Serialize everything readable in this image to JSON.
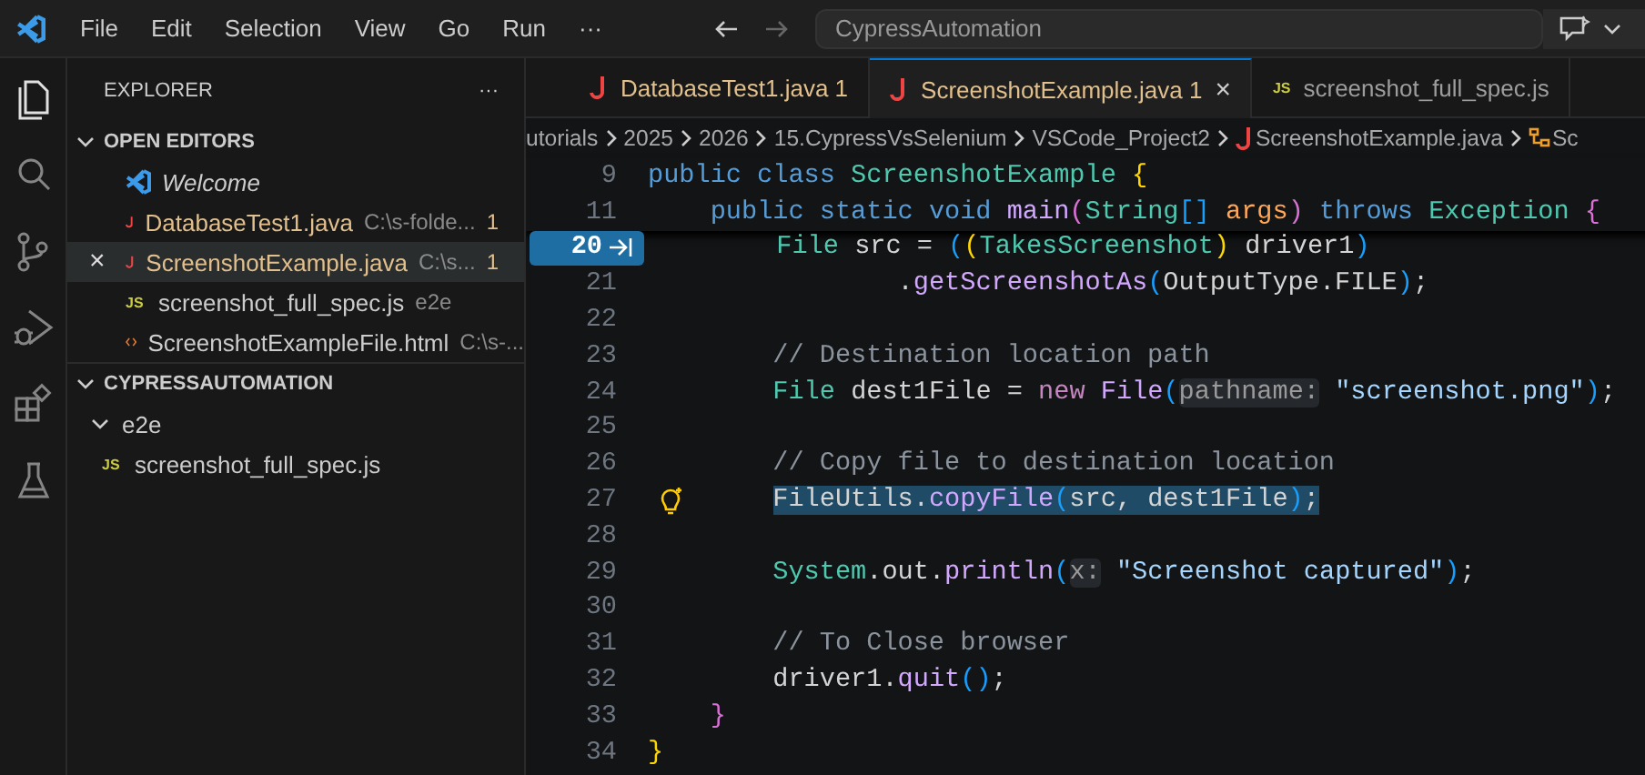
{
  "title_bar": {
    "menus": [
      "File",
      "Edit",
      "Selection",
      "View",
      "Go",
      "Run",
      "···"
    ],
    "search": {
      "value": "CypressAutomation"
    }
  },
  "activity_bar": {
    "items": [
      {
        "kind": "files",
        "selected": true
      },
      {
        "kind": "search",
        "selected": false
      },
      {
        "kind": "source-control",
        "selected": false
      },
      {
        "kind": "run-debug",
        "selected": false
      },
      {
        "kind": "extensions",
        "selected": false
      },
      {
        "kind": "testing",
        "selected": false
      }
    ]
  },
  "sidebar": {
    "title": "EXPLORER",
    "more": "···",
    "sections": [
      {
        "title": "OPEN EDITORS",
        "expanded": true,
        "items": [
          {
            "kind": "vscode",
            "name": "Welcome",
            "italic": true,
            "selected": false,
            "warning": false
          },
          {
            "kind": "java",
            "name": "DatabaseTest1.java",
            "detail": "C:\\s-folde...",
            "badge": "1",
            "selected": false,
            "warning": true
          },
          {
            "kind": "java",
            "name": "ScreenshotExample.java",
            "detail": "C:\\s...",
            "badge": "1",
            "selected": true,
            "warning": true,
            "close": "×"
          },
          {
            "kind": "js",
            "icon": "JS",
            "name": "screenshot_full_spec.js",
            "detail": "e2e",
            "selected": false,
            "warning": false
          },
          {
            "kind": "html",
            "name": "ScreenshotExampleFile.html",
            "detail": "C:\\s-...",
            "selected": false,
            "warning": false
          }
        ]
      },
      {
        "title": "CYPRESSAUTOMATION",
        "expanded": true,
        "tree": [
          {
            "kind": "folder",
            "name": "e2e",
            "expanded": true,
            "children": [
              {
                "kind": "js",
                "icon": "JS",
                "name": "screenshot_full_spec.js"
              }
            ]
          }
        ]
      }
    ]
  },
  "tabs": [
    {
      "kind": "java",
      "label": "DatabaseTest1.java",
      "badge": "1",
      "selected": false,
      "warning": true
    },
    {
      "kind": "java",
      "label": "ScreenshotExample.java",
      "badge": "1",
      "selected": true,
      "warning": true,
      "close": "×"
    },
    {
      "kind": "js",
      "icon": "JS",
      "label": "screenshot_full_spec.js",
      "selected": false,
      "warning": false
    }
  ],
  "breadcrumb": [
    {
      "kind": "folder",
      "label": "utorials"
    },
    {
      "kind": "folder",
      "label": "2025"
    },
    {
      "kind": "folder",
      "label": "2026"
    },
    {
      "kind": "folder",
      "label": "15.CypressVsSelenium"
    },
    {
      "kind": "folder",
      "label": "VSCode_Project2"
    },
    {
      "kind": "java",
      "label": "ScreenshotExample.java"
    },
    {
      "kind": "class",
      "label": "Sc"
    }
  ],
  "code": [
    {
      "number": "9",
      "sticky": true,
      "tokens": [
        {
          "text": "public class ",
          "kind": "keyword"
        },
        {
          "text": "ScreenshotExample ",
          "kind": "type"
        },
        {
          "text": "{",
          "kind": "bracket1"
        }
      ]
    },
    {
      "number": "11",
      "sticky": true,
      "tokens": [
        {
          "text": "    public static void ",
          "kind": "keyword"
        },
        {
          "text": "main",
          "kind": "method"
        },
        {
          "text": "(",
          "kind": "bracket2"
        },
        {
          "text": "String",
          "kind": "type"
        },
        {
          "text": "[]",
          "kind": "bracket3"
        },
        {
          "text": " args",
          "kind": "param"
        },
        {
          "text": ")",
          "kind": "bracket2"
        },
        {
          "text": " throws ",
          "kind": "keyword"
        },
        {
          "text": "Exception ",
          "kind": "type"
        },
        {
          "text": "{",
          "kind": "bracket2"
        }
      ]
    },
    {
      "number": "20",
      "current": true,
      "tokens": [
        {
          "text": "        File",
          "kind": "type"
        },
        {
          "text": " src = "
        },
        {
          "text": "(",
          "kind": "bracket3"
        },
        {
          "text": "(",
          "kind": "bracket1"
        },
        {
          "text": "TakesScreenshot",
          "kind": "type"
        },
        {
          "text": ")",
          "kind": "bracket1"
        },
        {
          "text": " driver1"
        },
        {
          "text": ")",
          "kind": "bracket3"
        }
      ]
    },
    {
      "number": "21",
      "tokens": [
        {
          "text": "                ."
        },
        {
          "text": "getScreenshotAs",
          "kind": "method"
        },
        {
          "text": "(",
          "kind": "bracket3"
        },
        {
          "text": "OutputType.FILE"
        },
        {
          "text": ")",
          "kind": "bracket3"
        },
        {
          "text": ";"
        }
      ]
    },
    {
      "number": "22"
    },
    {
      "number": "23",
      "tokens": [
        {
          "text": "        // Destination location path",
          "kind": "comment"
        }
      ]
    },
    {
      "number": "24",
      "tokens": [
        {
          "text": "        File",
          "kind": "type"
        },
        {
          "text": " dest1File = "
        },
        {
          "text": "new ",
          "kind": "keyword2"
        },
        {
          "text": "File",
          "kind": "method"
        },
        {
          "text": "(",
          "kind": "bracket3"
        },
        {
          "text": "pathname:",
          "kind": "hint"
        },
        {
          "text": " \"screenshot.png\"",
          "kind": "string"
        },
        {
          "text": ")",
          "kind": "bracket3"
        },
        {
          "text": ";"
        }
      ]
    },
    {
      "number": "25"
    },
    {
      "number": "26",
      "tokens": [
        {
          "text": "        // Copy file to destination location",
          "kind": "comment"
        }
      ]
    },
    {
      "number": "27",
      "lightbulb": true,
      "selected": true,
      "tokens": [
        {
          "text": "        FileUtils.",
          "kind": "sel"
        },
        {
          "text": "copyFile",
          "kind": "selmethod"
        },
        {
          "text": "(",
          "kind": "selbracket"
        },
        {
          "text": "src, dest1File",
          "kind": "sel"
        },
        {
          "text": ")",
          "kind": "selbracket"
        },
        {
          "text": ";",
          "kind": "sel"
        }
      ]
    },
    {
      "number": "28"
    },
    {
      "number": "29",
      "tokens": [
        {
          "text": "        System",
          "kind": "type"
        },
        {
          "text": ".out."
        },
        {
          "text": "println",
          "kind": "method"
        },
        {
          "text": "(",
          "kind": "bracket3"
        },
        {
          "text": "x:",
          "kind": "hint"
        },
        {
          "text": " \"Screenshot captured\"",
          "kind": "string"
        },
        {
          "text": ")",
          "kind": "bracket3"
        },
        {
          "text": ";"
        }
      ]
    },
    {
      "number": "30"
    },
    {
      "number": "31",
      "tokens": [
        {
          "text": "        // To Close browser",
          "kind": "comment"
        }
      ]
    },
    {
      "number": "32",
      "tokens": [
        {
          "text": "        driver1."
        },
        {
          "text": "quit",
          "kind": "method"
        },
        {
          "text": "()",
          "kind": "bracket3"
        },
        {
          "text": ";"
        }
      ]
    },
    {
      "number": "33",
      "tokens": [
        {
          "text": "    }",
          "kind": "bracket2"
        }
      ]
    },
    {
      "number": "34",
      "tokens": [
        {
          "text": "}",
          "kind": "bracket1"
        }
      ]
    }
  ]
}
